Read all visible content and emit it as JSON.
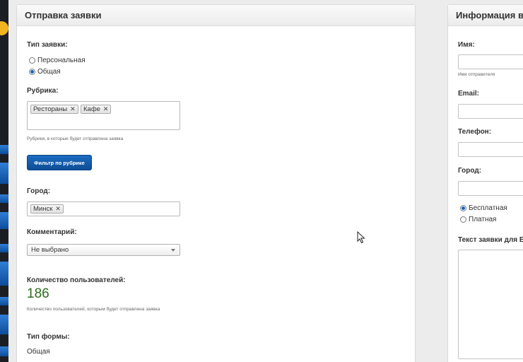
{
  "main_panel": {
    "title": "Отправка заявки",
    "request_type": {
      "label": "Тип заявки:",
      "options": [
        {
          "label": "Персональная",
          "selected": false
        },
        {
          "label": "Общая",
          "selected": true
        }
      ]
    },
    "rubric": {
      "label": "Рубрика:",
      "tags": [
        "Рестораны",
        "Кафе"
      ],
      "hint": "Рубрики, в которые будет отправлена заявка",
      "filter_button": "Фильтр по рубрике"
    },
    "city": {
      "label": "Город:",
      "tags": [
        "Минск"
      ]
    },
    "comment": {
      "label": "Комментарий:",
      "selected": "Не выбрано"
    },
    "users_count": {
      "label": "Количество пользователей:",
      "value": "186",
      "hint": "Количество пользователей, которым будет отправлена заявка"
    },
    "form_type": {
      "label": "Тип формы:",
      "value": "Общая"
    }
  },
  "info_panel": {
    "title": "Информация в з",
    "name_label": "Имя:",
    "name_hint": "Имя отправителя",
    "email_label": "Email:",
    "phone_label": "Телефон:",
    "city_label": "Город:",
    "plan_options": [
      {
        "label": "Бесплатная",
        "selected": true
      },
      {
        "label": "Платная",
        "selected": false
      }
    ],
    "email_text_label": "Текст заявки для Em"
  },
  "colors": {
    "accent": "#1565c0",
    "button": "#0d4d95",
    "count": "#2e6b1f"
  }
}
